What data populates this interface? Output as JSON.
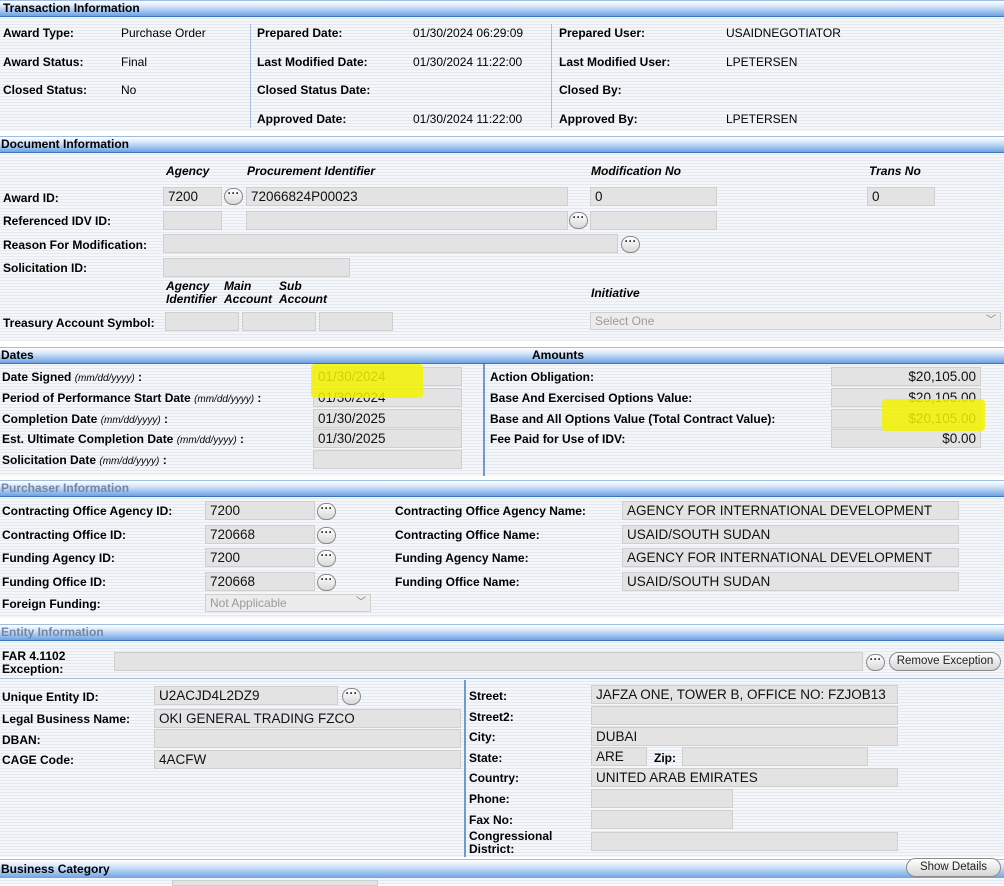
{
  "transaction": {
    "header": "Transaction Information",
    "award_type_label": "Award Type:",
    "award_type": "Purchase Order",
    "award_status_label": "Award Status:",
    "award_status": "Final",
    "closed_status_label": "Closed Status:",
    "closed_status": "No",
    "prepared_date_label": "Prepared Date:",
    "prepared_date": "01/30/2024 06:29:09",
    "last_modified_date_label": "Last Modified Date:",
    "last_modified_date": "01/30/2024 11:22:00",
    "closed_status_date_label": "Closed Status Date:",
    "approved_date_label": "Approved Date:",
    "approved_date": "01/30/2024 11:22:00",
    "prepared_user_label": "Prepared User:",
    "prepared_user": "USAIDNEGOTIATOR",
    "last_modified_user_label": "Last Modified User:",
    "last_modified_user": "LPETERSEN",
    "closed_by_label": "Closed By:",
    "approved_by_label": "Approved By:",
    "approved_by": "LPETERSEN"
  },
  "document": {
    "header": "Document Information",
    "col_agency": "Agency",
    "col_procurement": "Procurement Identifier",
    "col_mod": "Modification No",
    "col_trans": "Trans No",
    "award_id_label": "Award ID:",
    "award_agency": "7200",
    "award_proc": "72066824P00023",
    "award_mod": "0",
    "award_trans": "0",
    "ref_idv_label": "Referenced IDV ID:",
    "reason_label": "Reason For Modification:",
    "solicitation_label": "Solicitation ID:",
    "tas_col_agency": "Agency",
    "tas_col_identifier": "Identifier",
    "tas_col_main": "Main",
    "tas_col_main2": "Account",
    "tas_col_sub": "Sub",
    "tas_col_sub2": "Account",
    "initiative_label": "Initiative",
    "tas_label": "Treasury Account Symbol:",
    "initiative_select": "Select One"
  },
  "dates": {
    "header": "Dates",
    "date_signed_label": "Date Signed",
    "date_signed": "01/30/2024",
    "pop_start_label": "Period of Performance Start Date",
    "pop_start": "01/30/2024",
    "completion_label": "Completion Date",
    "completion": "01/30/2025",
    "ult_completion_label": "Est. Ultimate Completion Date",
    "ult_completion": "01/30/2025",
    "solicitation_date_label": "Solicitation Date",
    "format_hint": "(mm/dd/yyyy)",
    "colon": ":"
  },
  "amounts": {
    "header": "Amounts",
    "action_obligation_label": "Action Obligation:",
    "action_obligation": "$20,105.00",
    "base_exercised_label": "Base And Exercised Options Value:",
    "base_exercised": "$20,105.00",
    "base_all_label": "Base and All Options Value (Total Contract Value):",
    "base_all": "$20,105.00",
    "fee_idv_label": "Fee Paid for Use of IDV:",
    "fee_idv": "$0.00"
  },
  "purchaser": {
    "header": "Purchaser Information",
    "co_agency_id_label": "Contracting Office Agency ID:",
    "co_agency_id": "7200",
    "co_id_label": "Contracting Office ID:",
    "co_id": "720668",
    "funding_agency_id_label": "Funding Agency ID:",
    "funding_agency_id": "7200",
    "funding_office_id_label": "Funding Office ID:",
    "funding_office_id": "720668",
    "foreign_funding_label": "Foreign Funding:",
    "foreign_funding": "Not Applicable",
    "co_agency_name_label": "Contracting Office Agency Name:",
    "co_agency_name": "AGENCY FOR INTERNATIONAL DEVELOPMENT",
    "co_name_label": "Contracting Office Name:",
    "co_name": "USAID/SOUTH SUDAN",
    "funding_agency_name_label": "Funding Agency Name:",
    "funding_agency_name": "AGENCY FOR INTERNATIONAL DEVELOPMENT",
    "funding_office_name_label": "Funding Office Name:",
    "funding_office_name": "USAID/SOUTH SUDAN"
  },
  "entity": {
    "header": "Entity Information",
    "far_label_1": "FAR 4.1102",
    "far_label_2": "Exception:",
    "remove_exception": "Remove Exception",
    "uei_label": "Unique Entity ID:",
    "uei": "U2ACJD4L2DZ9",
    "legal_name_label": "Legal Business Name:",
    "legal_name": "OKI GENERAL TRADING FZCO",
    "dban_label": "DBAN:",
    "cage_label": "CAGE Code:",
    "cage": "4ACFW",
    "street_label": "Street:",
    "street": "JAFZA ONE, TOWER B, OFFICE NO: FZJOB13",
    "street2_label": "Street2:",
    "city_label": "City:",
    "city": "DUBAI",
    "state_label": "State:",
    "state": "ARE",
    "zip_label": "Zip:",
    "country_label": "Country:",
    "country": "UNITED ARAB EMIRATES",
    "phone_label": "Phone:",
    "fax_label": "Fax No:",
    "congressional_label_1": "Congressional",
    "congressional_label_2": "District:"
  },
  "business": {
    "header": "Business Category",
    "show_details": "Show Details"
  },
  "ellipsis_glyph": "···",
  "chevron_glyph": "﹀",
  "colors": {
    "header_top": "#d6e6fa",
    "header_bottom": "#6fa2e0",
    "highlight": "#f3f300",
    "field_bg": "#e3e3e3"
  }
}
